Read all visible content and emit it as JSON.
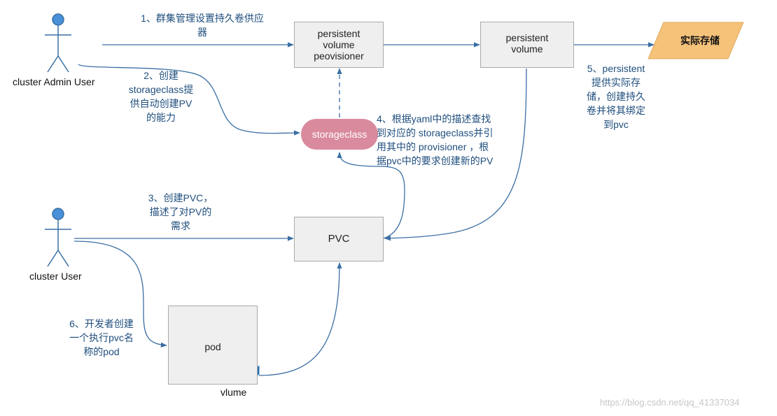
{
  "actors": {
    "admin": "cluster Admin User",
    "user": "cluster User"
  },
  "nodes": {
    "provisioner": "persistent\nvolume\npeovisioner",
    "pv": "persistent\nvolume",
    "storage": "实际存储",
    "storageclass": "storageclass",
    "pvc": "PVC",
    "pod": "pod",
    "volume": "vlume"
  },
  "steps": {
    "s1": "1、群集管理设置持久卷供应\n器",
    "s2": "2、创建\nstorageclass提\n供自动创建PV\n的能力",
    "s3": "3、创建PVC，\n描述了对PV的\n需求",
    "s4": "4、根据yaml中的描述查找\n到对应的 storageclass并引\n用其中的 provisioner ，根\n据pvc中的要求创建新的PV",
    "s5": "5、persistent\n提供实际存\n储，创建持久\n卷并将其绑定\n到pvc",
    "s6": "6、开发者创建\n一个执行pvc名\n称的pod"
  },
  "colors": {
    "line": "#3a6fa3",
    "box_fill": "#efefef",
    "box_border": "#a9a9a9",
    "storage_fill": "#f5c27a",
    "storageclass_fill": "#d98a9d",
    "actor_fill": "#4a90d9",
    "label_text": "#1f4e7d"
  },
  "watermark": "https://blog.csdn.net/qq_41337034"
}
